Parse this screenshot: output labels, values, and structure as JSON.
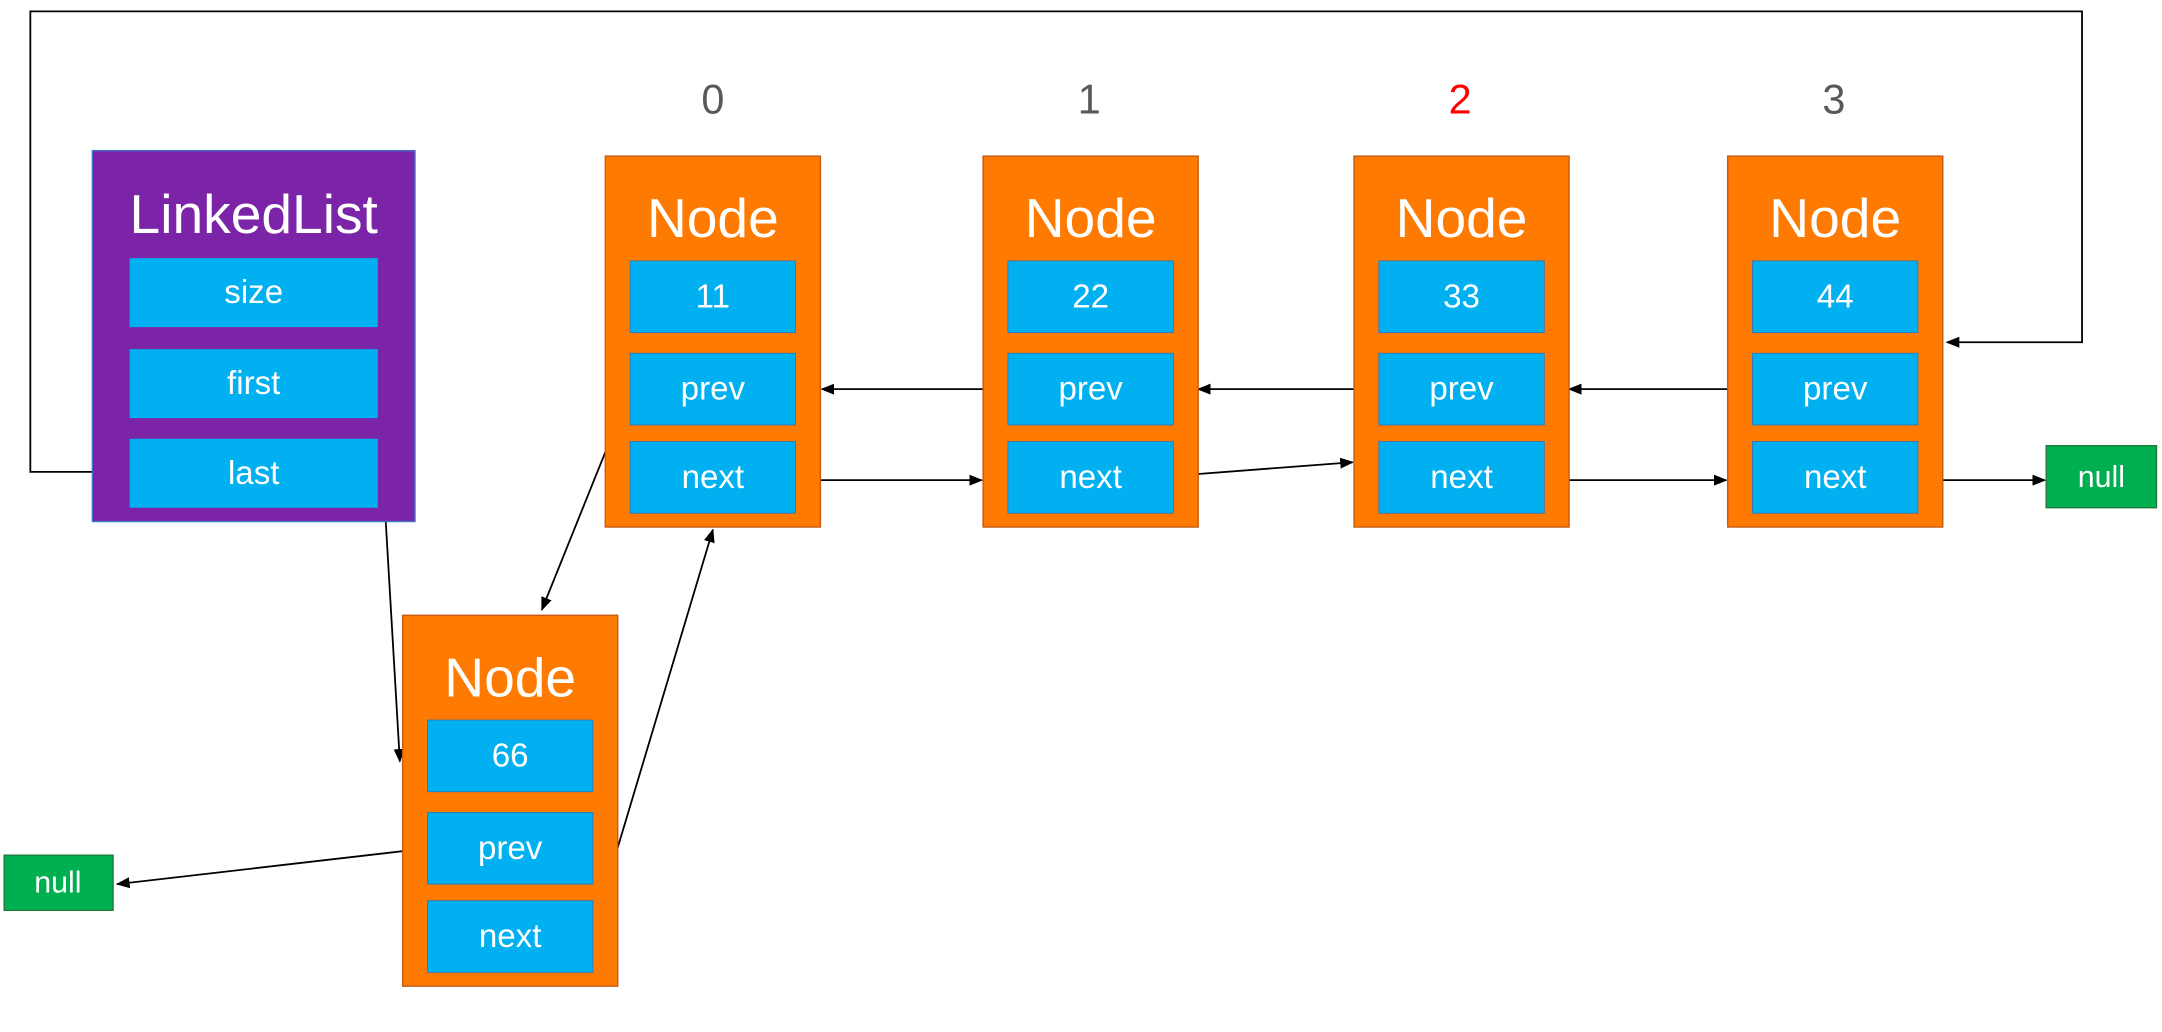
{
  "colors": {
    "linkedlist": "#7B24A8",
    "node": "#FF7A00",
    "field": "#00B0F0",
    "null": "#00B050",
    "index": "#595959",
    "highlight_index": "#FF0000"
  },
  "linkedlist": {
    "title": "LinkedList",
    "fields": [
      "size",
      "first",
      "last"
    ]
  },
  "indices": [
    "0",
    "1",
    "2",
    "3"
  ],
  "highlighted_index": "2",
  "nodes": [
    {
      "title": "Node",
      "value": "11",
      "prev": "prev",
      "next": "next"
    },
    {
      "title": "Node",
      "value": "22",
      "prev": "prev",
      "next": "next"
    },
    {
      "title": "Node",
      "value": "33",
      "prev": "prev",
      "next": "next"
    },
    {
      "title": "Node",
      "value": "44",
      "prev": "prev",
      "next": "next"
    }
  ],
  "new_node": {
    "title": "Node",
    "value": "66",
    "prev": "prev",
    "next": "next"
  },
  "null_right": "null",
  "null_left": "null"
}
